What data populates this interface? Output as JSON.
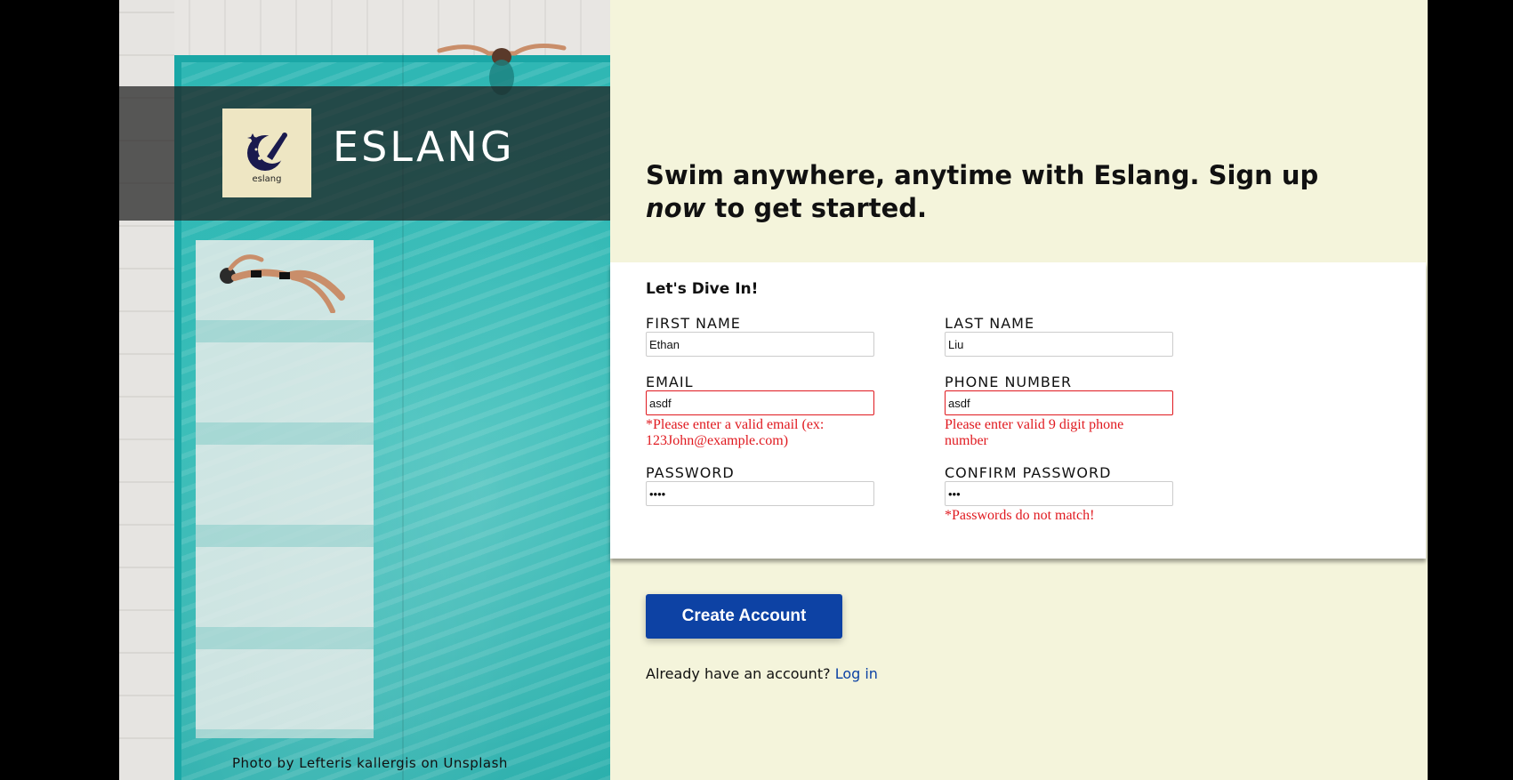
{
  "brand": {
    "name": "ESLANG",
    "logo_text": "eslang",
    "photo_credit": "Photo by Lefteris kallergis on Unsplash"
  },
  "headline": {
    "before": "Swim anywhere, anytime with Eslang. Sign up ",
    "emphasis": "now",
    "after": " to get started."
  },
  "form": {
    "title": "Let's Dive In!",
    "first_name": {
      "label": "FIRST NAME",
      "value": "Ethan"
    },
    "last_name": {
      "label": "LAST NAME",
      "value": "Liu"
    },
    "email": {
      "label": "EMAIL",
      "value": "asdf",
      "error": "*Please enter a valid email (ex: 123John@example.com)"
    },
    "phone": {
      "label": "PHONE NUMBER",
      "value": "asdf",
      "error": "Please enter valid 9 digit phone number"
    },
    "password": {
      "label": "PASSWORD",
      "value": "asdf"
    },
    "confirm_password": {
      "label": "CONFIRM PASSWORD",
      "value": "asd",
      "error": "*Passwords do not match!"
    }
  },
  "actions": {
    "create_account": "Create Account",
    "login_prompt": "Already have an account?",
    "login_link": "Log in"
  },
  "colors": {
    "right_background": "#f4f4db",
    "primary": "#0d42a4",
    "error": "#e0191f",
    "pool": "#2fb0ad"
  }
}
